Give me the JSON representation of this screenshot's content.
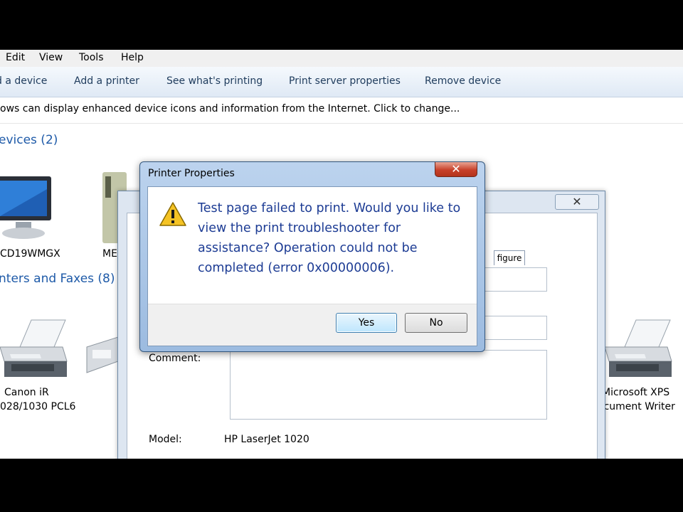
{
  "menu": [
    "Edit",
    "View",
    "Tools",
    "Help"
  ],
  "toolbar": [
    "d a device",
    "Add a printer",
    "See what's printing",
    "Print server properties",
    "Remove device"
  ],
  "info_bar": "ows can display enhanced device icons and information from the Internet. Click to change...",
  "groups": {
    "devices": "evices (2)",
    "printers": "nters and Faxes (8)"
  },
  "devices": {
    "monitor_label": "CD19WMGX",
    "media_label": "ME",
    "canon_label_1": "Canon iR",
    "canon_label_2": "028/1030 PCL6",
    "xps_label_1": "Microsoft XPS",
    "xps_label_2": "ocument Writer"
  },
  "properties_window": {
    "close_glyph": "✕",
    "tab_label": "figure",
    "comment_label": "Comment:",
    "model_label": "Model:",
    "model_value": "HP LaserJet 1020"
  },
  "dialog": {
    "title": "Printer Properties",
    "close_glyph": "✕",
    "message": "Test page failed to print. Would you like to view the print troubleshooter for assistance? Operation could not be completed (error 0x00000006).",
    "yes_label": "Yes",
    "no_label": "No"
  },
  "icons": [
    "warning-icon",
    "monitor-icon",
    "printer-icon",
    "fax-icon",
    "close-icon"
  ]
}
